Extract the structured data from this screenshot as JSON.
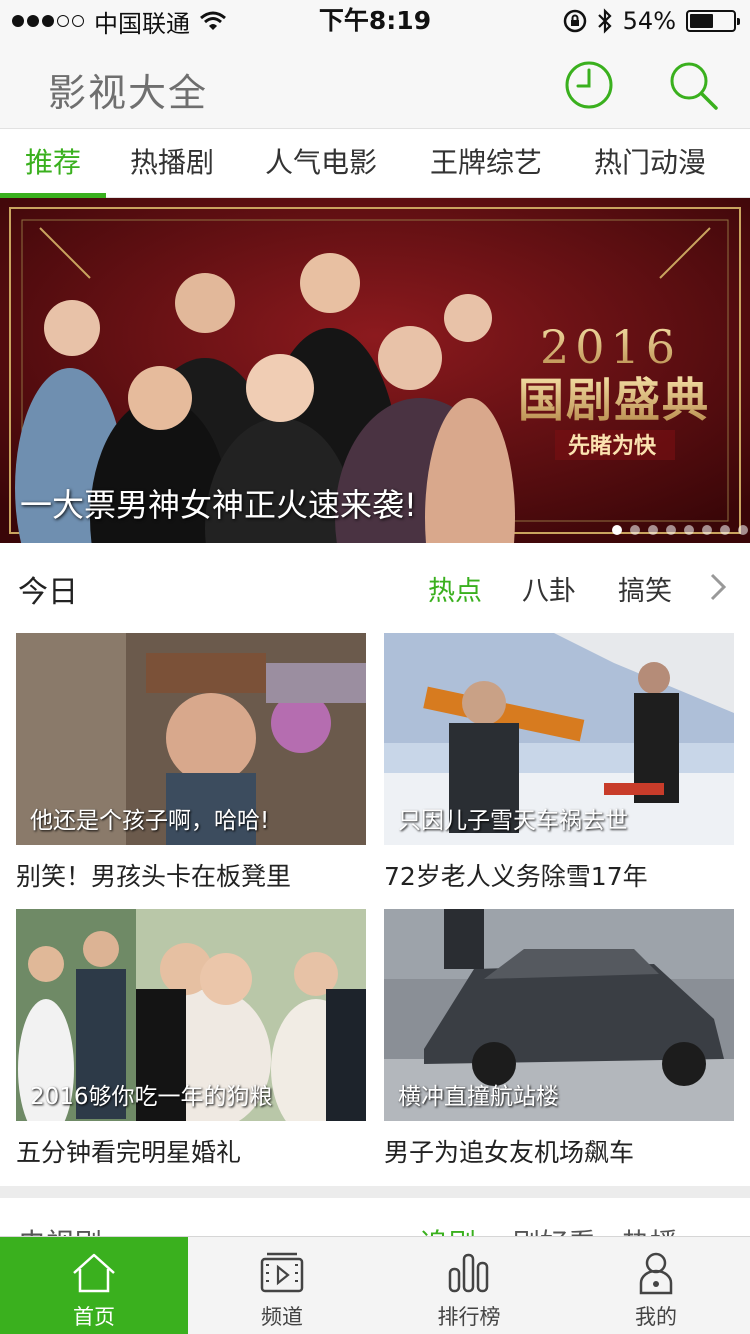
{
  "status_bar": {
    "carrier": "中国联通",
    "time": "下午8:19",
    "battery": "54%",
    "battery_level": 0.54,
    "signal_bars": 3
  },
  "header": {
    "title": "影视大全",
    "icons": [
      "history-icon",
      "search-icon"
    ]
  },
  "tabs": [
    {
      "label": "推荐",
      "active": true
    },
    {
      "label": "热播剧",
      "active": false
    },
    {
      "label": "人气电影",
      "active": false
    },
    {
      "label": "王牌综艺",
      "active": false
    },
    {
      "label": "热门动漫",
      "active": false
    }
  ],
  "banner": {
    "caption": "一大票男神女神正火速来袭!",
    "logo_text": "2016 国剧盛典",
    "sub_logo": "先睹为快",
    "page_count": 8,
    "current_page": 1
  },
  "today": {
    "title": "今日",
    "tags": [
      {
        "label": "热点",
        "active": true
      },
      {
        "label": "八卦",
        "active": false
      },
      {
        "label": "搞笑",
        "active": false
      }
    ],
    "cards": [
      {
        "caption": "他还是个孩子啊，哈哈!",
        "title": "别笑！男孩头卡在板凳里"
      },
      {
        "caption": "只因儿子雪天车祸去世",
        "title": "72岁老人义务除雪17年"
      },
      {
        "caption": "2016够你吃一年的狗粮",
        "title": "五分钟看完明星婚礼"
      },
      {
        "caption": "横冲直撞航站楼",
        "title": "男子为追女友机场飙车"
      }
    ]
  },
  "next_section": {
    "title": "电视剧",
    "tags": [
      {
        "label": "追剧",
        "active": true
      },
      {
        "label": "剧好看",
        "active": false
      },
      {
        "label": "热播",
        "active": false
      }
    ]
  },
  "tab_bar": [
    {
      "label": "首页",
      "icon": "home-icon",
      "active": true
    },
    {
      "label": "频道",
      "icon": "channel-icon",
      "active": false
    },
    {
      "label": "排行榜",
      "icon": "ranking-icon",
      "active": false
    },
    {
      "label": "我的",
      "icon": "profile-icon",
      "active": false
    }
  ],
  "colors": {
    "accent": "#3ab01e",
    "header_bg": "#f7f7f7",
    "banner_bg": "#5a0d10"
  }
}
